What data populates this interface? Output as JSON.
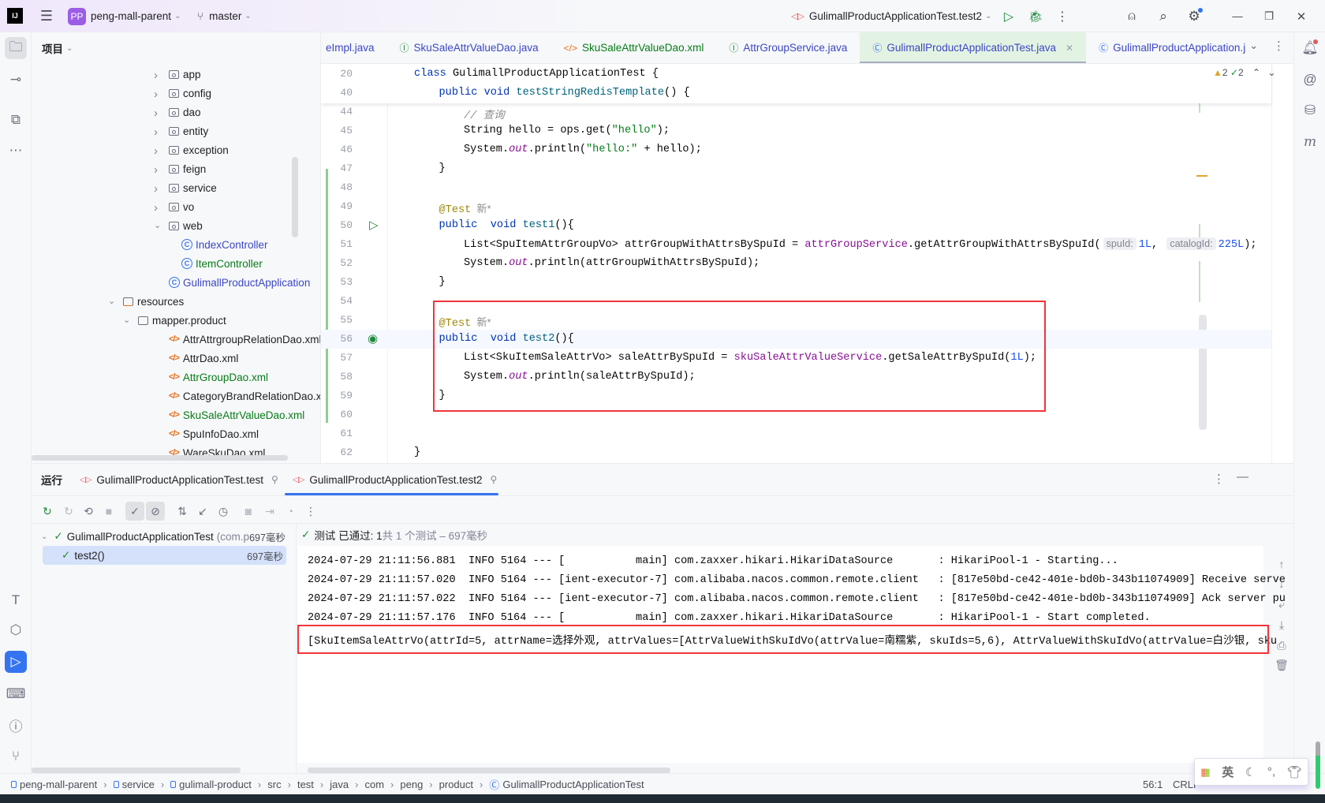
{
  "titlebar": {
    "project_badge": "PP",
    "project_name": "peng-mall-parent",
    "branch": "master",
    "run_config": "GulimallProductApplicationTest.test2",
    "accent": "#9b5de5"
  },
  "project_panel": {
    "title": "项目",
    "items": [
      {
        "label": "app",
        "kind": "pkg",
        "level": 3,
        "chev": "›",
        "color": "def"
      },
      {
        "label": "config",
        "kind": "pkg",
        "level": 3,
        "chev": "›",
        "color": "def"
      },
      {
        "label": "dao",
        "kind": "pkg",
        "level": 3,
        "chev": "›",
        "color": "def"
      },
      {
        "label": "entity",
        "kind": "pkg",
        "level": 3,
        "chev": "›",
        "color": "def"
      },
      {
        "label": "exception",
        "kind": "pkg",
        "level": 3,
        "chev": "›",
        "color": "def"
      },
      {
        "label": "feign",
        "kind": "pkg",
        "level": 3,
        "chev": "›",
        "color": "def"
      },
      {
        "label": "service",
        "kind": "pkg",
        "level": 3,
        "chev": "›",
        "color": "def"
      },
      {
        "label": "vo",
        "kind": "pkg",
        "level": 3,
        "chev": "›",
        "color": "def"
      },
      {
        "label": "web",
        "kind": "pkg",
        "level": 3,
        "chev": "⌄",
        "color": "def"
      },
      {
        "label": "IndexController",
        "kind": "class",
        "level": 4,
        "chev": "",
        "color": "mod"
      },
      {
        "label": "ItemController",
        "kind": "class",
        "level": 4,
        "chev": "",
        "color": "add"
      },
      {
        "label": "GulimallProductApplication",
        "kind": "class",
        "level": 3,
        "chev": "",
        "color": "mod"
      },
      {
        "label": "resources",
        "kind": "res",
        "level": 1,
        "chev": "⌄",
        "color": "def"
      },
      {
        "label": "mapper.product",
        "kind": "folder",
        "level": 2,
        "chev": "⌄",
        "color": "def"
      },
      {
        "label": "AttrAttrgroupRelationDao.xml",
        "kind": "xml",
        "level": 3,
        "chev": "",
        "color": "def"
      },
      {
        "label": "AttrDao.xml",
        "kind": "xml",
        "level": 3,
        "chev": "",
        "color": "def"
      },
      {
        "label": "AttrGroupDao.xml",
        "kind": "xml",
        "level": 3,
        "chev": "",
        "color": "add"
      },
      {
        "label": "CategoryBrandRelationDao.xml",
        "kind": "xml",
        "level": 3,
        "chev": "",
        "color": "def"
      },
      {
        "label": "SkuSaleAttrValueDao.xml",
        "kind": "xml",
        "level": 3,
        "chev": "",
        "color": "add"
      },
      {
        "label": "SpuInfoDao.xml",
        "kind": "xml",
        "level": 3,
        "chev": "",
        "color": "def"
      },
      {
        "label": "WareSkuDao.xml",
        "kind": "xml",
        "level": 3,
        "chev": "",
        "color": "def"
      }
    ]
  },
  "editor_tabs": [
    {
      "label": "eImpl.java",
      "icon": "",
      "color": "mod"
    },
    {
      "label": "SkuSaleAttrValueDao.java",
      "icon": "interface",
      "color": "mod"
    },
    {
      "label": "SkuSaleAttrValueDao.xml",
      "icon": "xml",
      "color": "add"
    },
    {
      "label": "AttrGroupService.java",
      "icon": "interface",
      "color": "mod"
    },
    {
      "label": "GulimallProductApplicationTest.java",
      "icon": "class",
      "color": "mod",
      "active": true
    },
    {
      "label": "GulimallProductApplication.j",
      "icon": "class",
      "color": "mod"
    }
  ],
  "editor": {
    "inspections": {
      "warnings": "2",
      "ok": "2"
    },
    "sticky": [
      {
        "n": "20",
        "indent": 0,
        "tokens": [
          {
            "t": "class ",
            "c": "kw"
          },
          {
            "t": "GulimallProductApplicationTest {",
            "c": ""
          }
        ]
      },
      {
        "n": "40",
        "indent": 1,
        "tokens": [
          {
            "t": "public ",
            "c": "kw"
          },
          {
            "t": "void ",
            "c": "kw"
          },
          {
            "t": "testStringRedisTemplate",
            "c": "fn"
          },
          {
            "t": "() {",
            "c": ""
          }
        ]
      }
    ],
    "lines": [
      {
        "n": "44",
        "indent": 2,
        "tokens": [
          {
            "t": "// 查询",
            "c": "cm"
          }
        ]
      },
      {
        "n": "45",
        "indent": 2,
        "tokens": [
          {
            "t": "String hello = ops.get(",
            "c": ""
          },
          {
            "t": "\"hello\"",
            "c": "str"
          },
          {
            "t": ");",
            "c": ""
          }
        ]
      },
      {
        "n": "46",
        "indent": 2,
        "tokens": [
          {
            "t": "System.",
            "c": ""
          },
          {
            "t": "out",
            "c": "sfld"
          },
          {
            "t": ".println(",
            "c": ""
          },
          {
            "t": "\"hello:\"",
            "c": "str"
          },
          {
            "t": " + hello);",
            "c": ""
          }
        ]
      },
      {
        "n": "47",
        "indent": 1,
        "tokens": [
          {
            "t": "}",
            "c": ""
          }
        ]
      },
      {
        "n": "48",
        "indent": 0,
        "tokens": []
      },
      {
        "n": "49",
        "indent": 1,
        "tokens": [
          {
            "t": "@Test",
            "c": "ann"
          },
          {
            "t": "  新*",
            "c": "hintg"
          }
        ]
      },
      {
        "n": "50",
        "indent": 1,
        "gutter": "run",
        "tokens": [
          {
            "t": "public",
            "c": "kw"
          },
          {
            "t": "  void ",
            "c": "kw"
          },
          {
            "t": "test1",
            "c": "fn"
          },
          {
            "t": "(){",
            "c": ""
          }
        ]
      },
      {
        "n": "51",
        "indent": 2,
        "tokens": [
          {
            "t": "List<SpuItemAttrGroupVo> attrGroupWithAttrsBySpuId = ",
            "c": ""
          },
          {
            "t": "attrGroupService",
            "c": "fld"
          },
          {
            "t": ".getAttrGroupWithAttrsBySpuId(",
            "c": ""
          },
          {
            "t": "spuId:",
            "c": "hint"
          },
          {
            "t": "1L",
            "c": "num"
          },
          {
            "t": ", ",
            "c": ""
          },
          {
            "t": "catalogId:",
            "c": "hint"
          },
          {
            "t": "225L",
            "c": "num"
          },
          {
            "t": ");",
            "c": ""
          }
        ]
      },
      {
        "n": "52",
        "indent": 2,
        "tokens": [
          {
            "t": "System.",
            "c": ""
          },
          {
            "t": "out",
            "c": "sfld"
          },
          {
            "t": ".println(attrGroupWithAttrsBySpuId);",
            "c": ""
          }
        ]
      },
      {
        "n": "53",
        "indent": 1,
        "tokens": [
          {
            "t": "}",
            "c": ""
          }
        ]
      },
      {
        "n": "54",
        "indent": 0,
        "tokens": []
      },
      {
        "n": "55",
        "indent": 1,
        "tokens": [
          {
            "t": "@Test",
            "c": "ann"
          },
          {
            "t": "  新*",
            "c": "hintg"
          }
        ]
      },
      {
        "n": "56",
        "indent": 1,
        "gutter": "passed",
        "current": true,
        "tokens": [
          {
            "t": "public",
            "c": "kw"
          },
          {
            "t": "  void ",
            "c": "kw"
          },
          {
            "t": "test2",
            "c": "fn"
          },
          {
            "t": "(){",
            "c": ""
          }
        ]
      },
      {
        "n": "57",
        "indent": 2,
        "tokens": [
          {
            "t": "List<SkuItemSaleAttrVo> saleAttrBySpuId = ",
            "c": ""
          },
          {
            "t": "skuSaleAttrValueService",
            "c": "fld"
          },
          {
            "t": ".getSaleAttrBySpuId(",
            "c": ""
          },
          {
            "t": "1L",
            "c": "num"
          },
          {
            "t": ");",
            "c": ""
          }
        ]
      },
      {
        "n": "58",
        "indent": 2,
        "tokens": [
          {
            "t": "System.",
            "c": ""
          },
          {
            "t": "out",
            "c": "sfld"
          },
          {
            "t": ".println(saleAttrBySpuId);",
            "c": ""
          }
        ]
      },
      {
        "n": "59",
        "indent": 1,
        "tokens": [
          {
            "t": "}",
            "c": ""
          }
        ]
      },
      {
        "n": "60",
        "indent": 0,
        "tokens": []
      },
      {
        "n": "61",
        "indent": 0,
        "tokens": []
      },
      {
        "n": "62",
        "indent": 0,
        "tokens": [
          {
            "t": "}",
            "c": ""
          }
        ]
      }
    ]
  },
  "run_panel": {
    "title": "运行",
    "tabs": [
      {
        "label": "GulimallProductApplicationTest.test"
      },
      {
        "label": "GulimallProductApplicationTest.test2",
        "active": true
      }
    ],
    "tree": [
      {
        "label": "GulimallProductApplicationTest",
        "detail": "(com.p",
        "time": "697毫秒"
      },
      {
        "label": "test2()",
        "time": "697毫秒",
        "selected": true
      }
    ],
    "status": {
      "prefix": "测试 已通过: 1",
      "suffix": "共 1 个测试 – 697毫秒"
    },
    "console": [
      "2024-07-29 21:11:56.881  INFO 5164 --- [           main] com.zaxxer.hikari.HikariDataSource       : HikariPool-1 - Starting...",
      "2024-07-29 21:11:57.020  INFO 5164 --- [ient-executor-7] com.alibaba.nacos.common.remote.client   : [817e50bd-ce42-401e-bd0b-343b11074909] Receive serve",
      "2024-07-29 21:11:57.022  INFO 5164 --- [ient-executor-7] com.alibaba.nacos.common.remote.client   : [817e50bd-ce42-401e-bd0b-343b11074909] Ack server pu",
      "2024-07-29 21:11:57.176  INFO 5164 --- [           main] com.zaxxer.hikari.HikariDataSource       : HikariPool-1 - Start completed.",
      "[SkuItemSaleAttrVo(attrId=5, attrName=选择外观, attrValues=[AttrValueWithSkuIdVo(attrValue=南糯紫, skuIds=5,6), AttrValueWithSkuIdVo(attrValue=白沙银, sku"
    ]
  },
  "statusbar": {
    "breadcrumbs": [
      "peng-mall-parent",
      "service",
      "gulimall-product",
      "src",
      "test",
      "java",
      "com",
      "peng",
      "product",
      "GulimallProductApplicationTest"
    ],
    "position": "56:1",
    "line_ending": "CRLF"
  },
  "ime": {
    "mode": "英"
  },
  "colors": {
    "highlight": "#f0343a",
    "run_selected": "#3574f0",
    "added": "#067d17",
    "modified": "#3b47c2"
  }
}
